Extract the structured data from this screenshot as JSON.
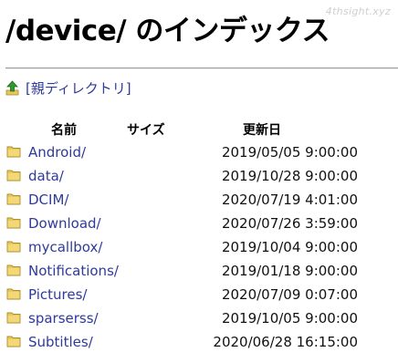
{
  "watermark": "4thsight.xyz",
  "page": {
    "title": "/device/ のインデックス",
    "parent_link": "[親ディレクトリ]"
  },
  "columns": {
    "name": "名前",
    "size": "サイズ",
    "modified": "更新日"
  },
  "entries": [
    {
      "name": "Android/",
      "modified": "2019/05/05 9:00:00"
    },
    {
      "name": "data/",
      "modified": "2019/10/28 9:00:00"
    },
    {
      "name": "DCIM/",
      "modified": "2020/07/19 4:01:00"
    },
    {
      "name": "Download/",
      "modified": "2020/07/26 3:59:00"
    },
    {
      "name": "mycallbox/",
      "modified": "2019/10/04 9:00:00"
    },
    {
      "name": "Notifications/",
      "modified": "2019/01/18 9:00:00"
    },
    {
      "name": "Pictures/",
      "modified": "2020/07/09 0:07:00"
    },
    {
      "name": "sparserss/",
      "modified": "2019/10/05 9:00:00"
    },
    {
      "name": "Subtitles/",
      "modified": "2020/06/28 16:15:00"
    }
  ],
  "colors": {
    "link": "#2f3a9a",
    "folder": "#e8c75c",
    "up_arrow": "#2e9a2e"
  },
  "icons": {
    "parent": "up-arrow-icon",
    "entry": "folder-icon"
  }
}
